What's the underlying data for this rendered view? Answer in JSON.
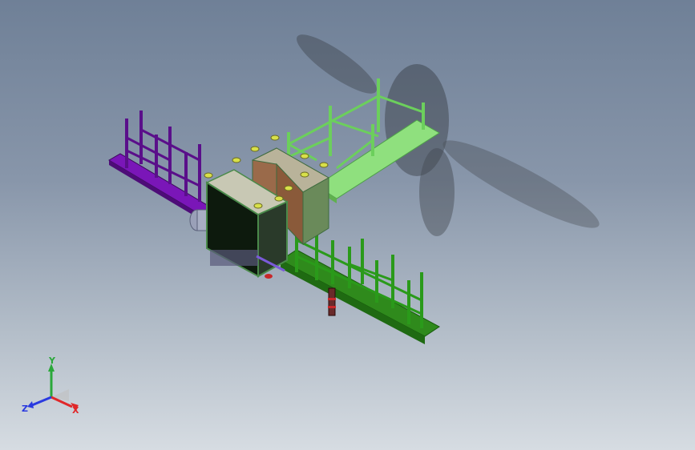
{
  "viewport": {
    "background_top": "#6f8097",
    "background_bottom": "#d6dce2"
  },
  "model": {
    "colors": {
      "purple_rack": "#7a16b8",
      "green_dark": "#2f8a1c",
      "green_light": "#8fe07e",
      "cabinet_frame": "#4a8a4a",
      "cabinet_panel": "#0d1a0d",
      "rear_panel": "#8a5a3a",
      "yellow_fitting": "#d8e04a",
      "gray_motor": "#9aa0b8",
      "red_accent": "#c8282a"
    }
  },
  "triad": {
    "x_label": "X",
    "y_label": "Y",
    "z_label": "Z",
    "x_color": "#e0282a",
    "y_color": "#2aa83a",
    "z_color": "#2a3ae0"
  }
}
